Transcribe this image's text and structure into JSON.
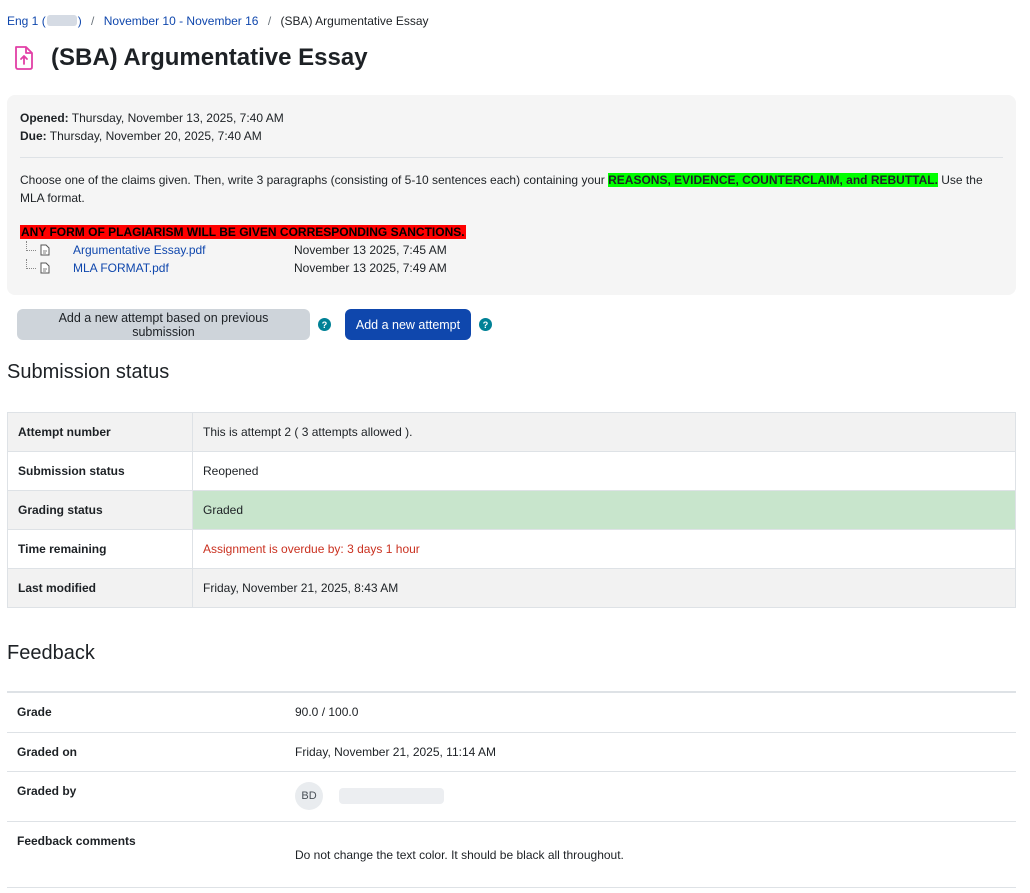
{
  "breadcrumb": {
    "course_prefix": "Eng 1 (",
    "course_suffix": ")",
    "week": "November 10 - November 16",
    "current": "(SBA) Argumentative Essay"
  },
  "page": {
    "title": "(SBA) Argumentative Essay",
    "icon": "assignment-upload-icon",
    "accent_color": "#e23fa6"
  },
  "dates": {
    "opened_label": "Opened:",
    "opened_value": "Thursday, November 13, 2025, 7:40 AM",
    "due_label": "Due:",
    "due_value": "Thursday, November 20, 2025, 7:40 AM"
  },
  "description": {
    "text_before": "Choose one of the claims given. Then, write 3 paragraphs (consisting of 5-10 sentences each) containing your ",
    "highlight": "REASONS, EVIDENCE, COUNTERCLAIM, and REBUTTAL.",
    "text_after": " Use the MLA format.",
    "warning": "ANY FORM OF PLAGIARISM WILL BE GIVEN CORRESPONDING SANCTIONS."
  },
  "files": [
    {
      "name": "Argumentative Essay.pdf",
      "date": "November 13 2025, 7:45 AM"
    },
    {
      "name": "MLA FORMAT.pdf",
      "date": "November 13 2025, 7:49 AM"
    }
  ],
  "actions": {
    "previous_attempt_label": "Add a new attempt based on previous submission",
    "new_attempt_label": "Add a new attempt",
    "help_glyph": "?"
  },
  "submission": {
    "heading": "Submission status",
    "rows": [
      {
        "label": "Attempt number",
        "value": "This is attempt 2 ( 3 attempts allowed )."
      },
      {
        "label": "Submission status",
        "value": "Reopened"
      },
      {
        "label": "Grading status",
        "value": "Graded"
      },
      {
        "label": "Time remaining",
        "value": "Assignment is overdue by: 3 days 1 hour"
      },
      {
        "label": "Last modified",
        "value": "Friday, November 21, 2025, 8:43 AM"
      }
    ]
  },
  "feedback": {
    "heading": "Feedback",
    "grade_label": "Grade",
    "grade_value": "90.0 / 100.0",
    "graded_on_label": "Graded on",
    "graded_on_value": "Friday, November 21, 2025, 11:14 AM",
    "graded_by_label": "Graded by",
    "grader_initials": "BD",
    "comments_label": "Feedback comments",
    "comments_value": "Do not change the text color. It should be black all throughout."
  },
  "colors": {
    "link": "#0f47ad",
    "primary_button": "#0f47ad",
    "graded_bg": "#c8e5cc",
    "overdue_text": "#ca3120",
    "highlight_green": "#00ff00",
    "warning_red": "#ff0000",
    "help_icon": "#008196"
  }
}
